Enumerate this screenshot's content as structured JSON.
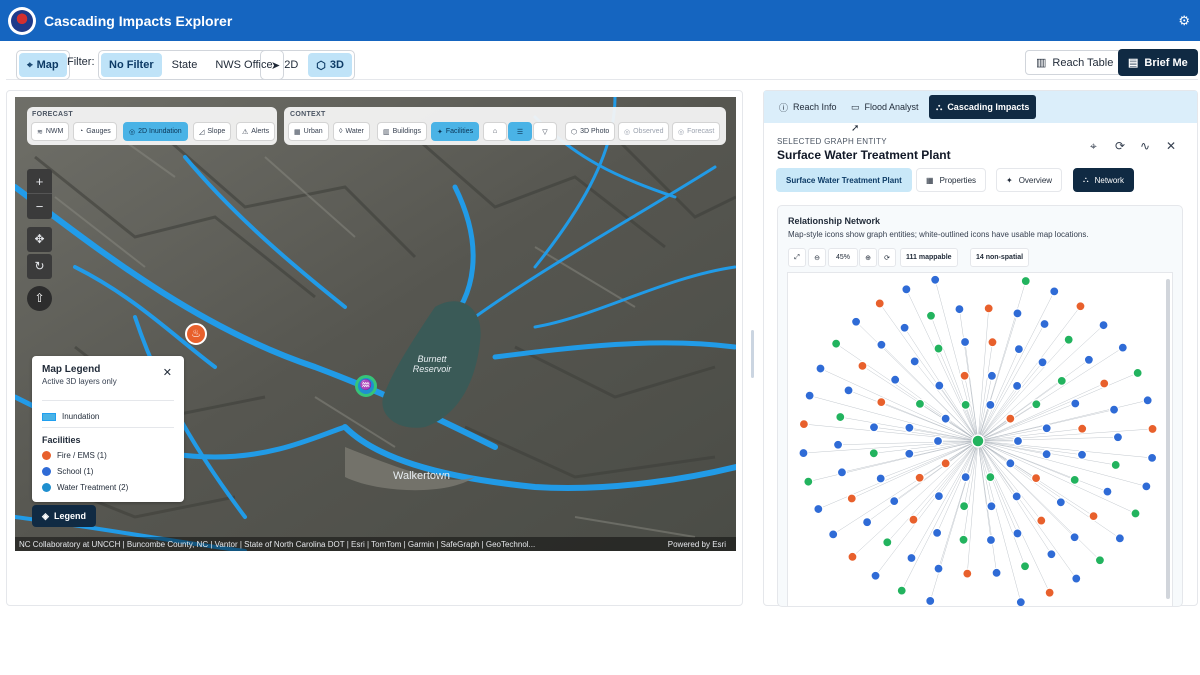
{
  "app": {
    "title": "Cascading Impacts Explorer"
  },
  "toolbar": {
    "map_label": "Map",
    "filter_label": "Filter:",
    "filter_options": [
      "No Filter",
      "State",
      "NWS Office"
    ],
    "filter_selected": "No Filter",
    "view_2d": "2D",
    "view_3d": "3D",
    "reach_table": "Reach Table",
    "brief_me": "Brief Me"
  },
  "map": {
    "forecast_label": "FORECAST",
    "forecast_chips": [
      "NWM",
      "Gauges",
      "2D Inundation",
      "Slope",
      "Alerts"
    ],
    "context_label": "CONTEXT",
    "context_chips": [
      "Urban",
      "Water",
      "Buildings",
      "Facilities"
    ],
    "photo_chips": [
      "3D Photo",
      "Observed",
      "Forecast"
    ],
    "places": [
      "Burnett Reservoir",
      "Walkertown"
    ],
    "attribution": "NC Collaboratory at UNCCH | Buncombe County, NC | Vantor | State of North Carolina DOT | Esri | TomTom | Garmin | SafeGraph | GeoTechnol...",
    "powered_by": "Powered by Esri",
    "legend_button": "Legend",
    "legend": {
      "title": "Map Legend",
      "subtitle": "Active 3D layers only",
      "inundation": "Inundation",
      "facilities_heading": "Facilities",
      "items": [
        {
          "label": "Fire / EMS (1)",
          "color": "#e8602c"
        },
        {
          "label": "School (1)",
          "color": "#2f6bd6"
        },
        {
          "label": "Water Treatment (2)",
          "color": "#1f8fcf"
        }
      ]
    },
    "colors": {
      "inundation": "#1f9ff0",
      "accent": "#4ab3e6"
    }
  },
  "panel": {
    "tabs": [
      "Reach Info",
      "Flood Analyst",
      "Cascading Impacts"
    ],
    "active_tab": "Cascading Impacts",
    "selected_label": "SELECTED GRAPH ENTITY",
    "selected_title": "Surface Water Treatment Plant",
    "subtabs": [
      "Surface Water Treatment Plant",
      "Properties",
      "Overview",
      "Network"
    ],
    "network": {
      "title": "Relationship Network",
      "description": "Map-style icons show graph entities; white-outlined icons have usable map locations.",
      "zoom": "45%",
      "mappable": "111 mappable",
      "non_spatial": "14 non-spatial"
    }
  }
}
